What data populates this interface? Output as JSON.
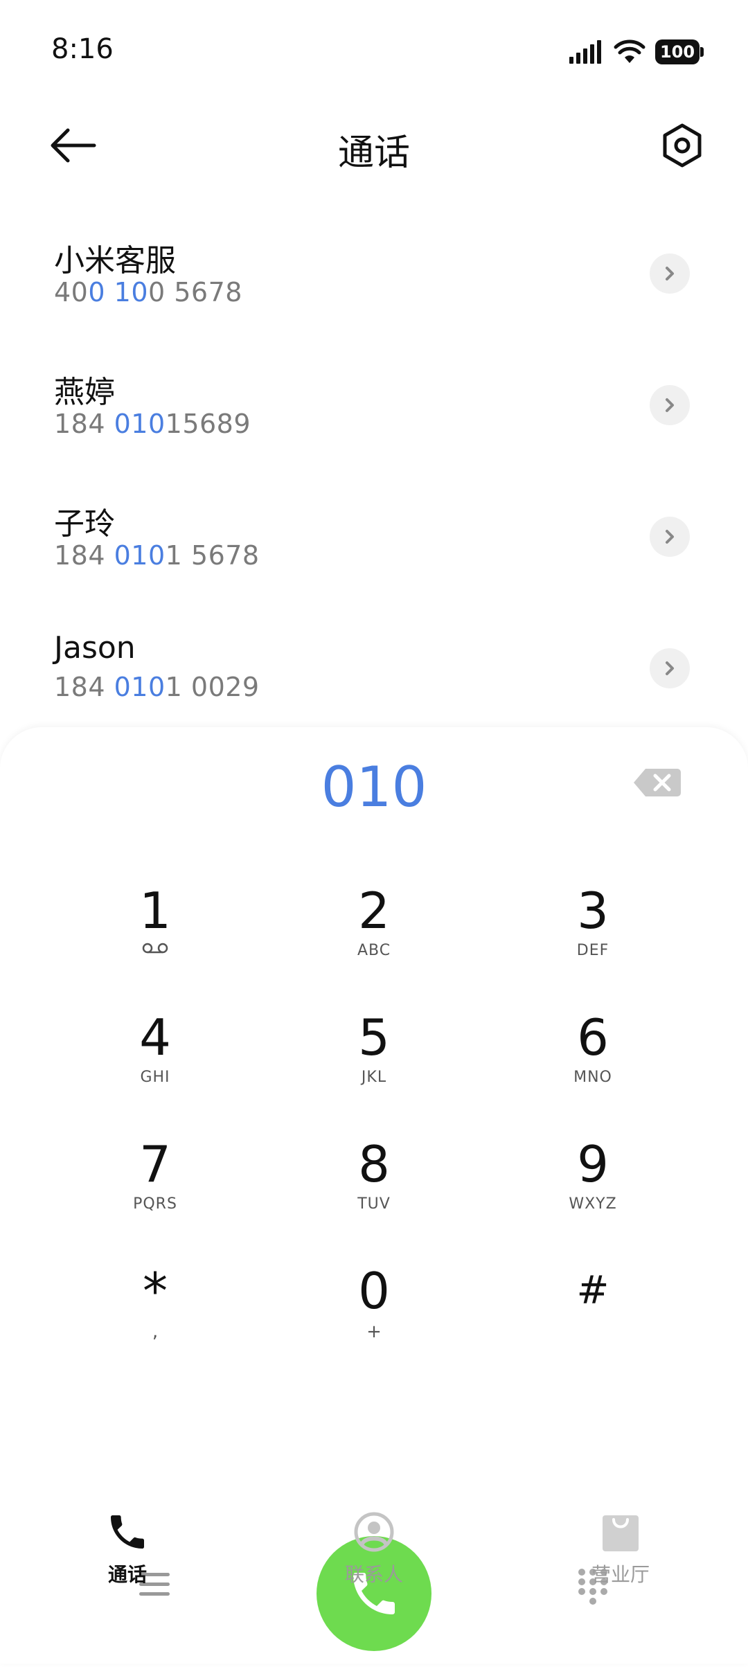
{
  "status_bar": {
    "time": "8:16",
    "battery": "100"
  },
  "header": {
    "title": "通话"
  },
  "results": [
    {
      "name": "小米客服",
      "number_parts": [
        "40",
        "0",
        " ",
        "10",
        "0 5678"
      ]
    },
    {
      "name": "燕婷",
      "number_parts": [
        "184 ",
        "010",
        "15689"
      ]
    },
    {
      "name": "子玲",
      "number_parts": [
        "184 ",
        "010",
        "1 5678"
      ]
    },
    {
      "name": "Jason",
      "number_parts": [
        "184 ",
        "010",
        "1 0029"
      ]
    }
  ],
  "dialpad": {
    "input": "010",
    "keys": [
      {
        "digit": "1",
        "sub": ""
      },
      {
        "digit": "2",
        "sub": "ABC"
      },
      {
        "digit": "3",
        "sub": "DEF"
      },
      {
        "digit": "4",
        "sub": "GHI"
      },
      {
        "digit": "5",
        "sub": "JKL"
      },
      {
        "digit": "6",
        "sub": "MNO"
      },
      {
        "digit": "7",
        "sub": "PQRS"
      },
      {
        "digit": "8",
        "sub": "TUV"
      },
      {
        "digit": "9",
        "sub": "WXYZ"
      },
      {
        "digit": "*",
        "sub": ","
      },
      {
        "digit": "0",
        "sub": "+"
      },
      {
        "digit": "#",
        "sub": ""
      }
    ]
  },
  "bottom_nav": {
    "calls": "通话",
    "contacts": "联系人",
    "store": "营业厅"
  },
  "colors": {
    "accent": "#4a7ee0",
    "call_green": "#6edb4f"
  }
}
